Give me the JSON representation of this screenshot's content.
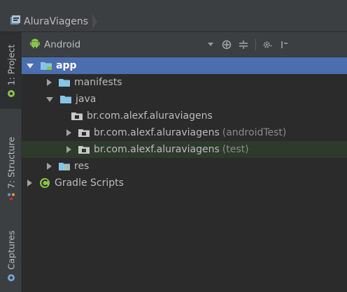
{
  "breadcrumb": {
    "project": "AluraViagens"
  },
  "sidebar": {
    "tabs": [
      {
        "label": "1: Project",
        "icon": "android-head-icon",
        "color": "#8bc34a"
      },
      {
        "label": "7: Structure",
        "icon": "structure-icon",
        "color": "#5b9bd5"
      },
      {
        "label": "Captures",
        "icon": "captures-icon",
        "color": "#7aa7d6"
      }
    ]
  },
  "panel": {
    "view_mode": "Android",
    "tools": [
      "sync-icon",
      "collapse-all-icon",
      "settings-icon",
      "hide-icon"
    ]
  },
  "tree": {
    "items": [
      {
        "label": "app",
        "suffix": "",
        "level": 0,
        "expander": "down",
        "icon": "module-folder-icon",
        "selected": true
      },
      {
        "label": "manifests",
        "suffix": "",
        "level": 1,
        "expander": "right",
        "icon": "folder-icon"
      },
      {
        "label": "java",
        "suffix": "",
        "level": 1,
        "expander": "down",
        "icon": "folder-icon"
      },
      {
        "label": "br.com.alexf.aluraviagens",
        "suffix": "",
        "level": 2,
        "expander": "none",
        "icon": "package-icon"
      },
      {
        "label": "br.com.alexf.aluraviagens",
        "suffix": "(androidTest)",
        "level": 2,
        "expander": "right",
        "icon": "package-icon"
      },
      {
        "label": "br.com.alexf.aluraviagens",
        "suffix": "(test)",
        "level": 2,
        "expander": "right",
        "icon": "package-icon",
        "test": true
      },
      {
        "label": "res",
        "suffix": "",
        "level": 1,
        "expander": "right",
        "icon": "resource-folder-icon"
      },
      {
        "label": "Gradle Scripts",
        "suffix": "",
        "level": 0,
        "expander": "right",
        "icon": "gradle-icon"
      }
    ]
  },
  "colors": {
    "selection": "#4b6eaf",
    "folder": "#87c5e8",
    "background": "#2b2b2b",
    "chrome": "#3c3f41",
    "android": "#8bc34a"
  }
}
